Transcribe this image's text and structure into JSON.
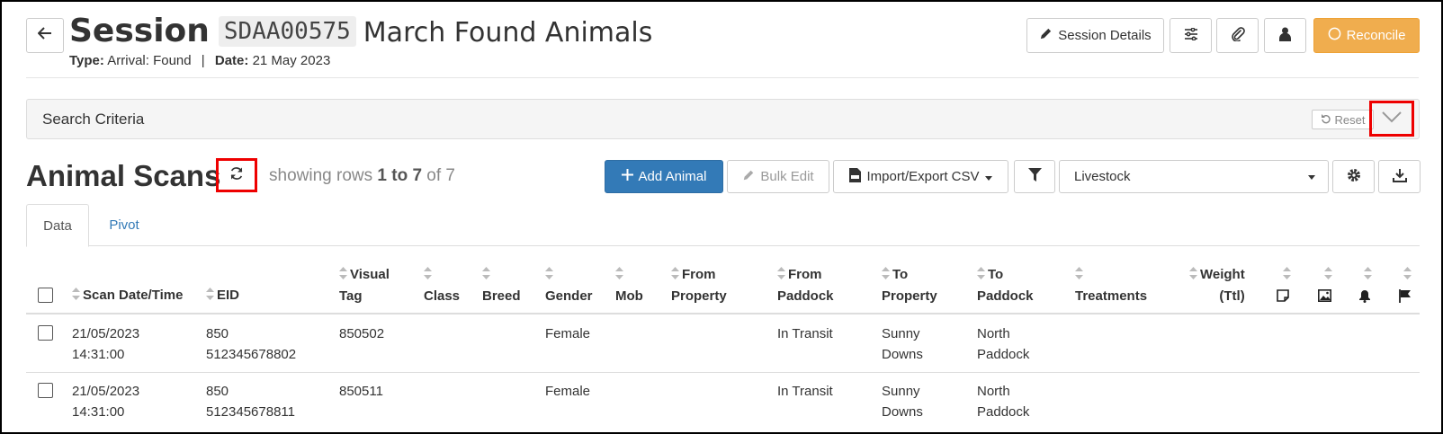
{
  "session": {
    "title_word": "Session",
    "code": "SDAA00575",
    "name": "March Found Animals",
    "type_label": "Type:",
    "type_value": "Arrival: Found",
    "separator": "|",
    "date_label": "Date:",
    "date_value": "21 May 2023"
  },
  "header_buttons": {
    "session_details": "Session Details",
    "reconcile": "Reconcile"
  },
  "search": {
    "label": "Search Criteria",
    "reset": "Reset"
  },
  "scans": {
    "title": "Animal Scans",
    "showing_prefix": "showing rows",
    "showing_range": "1 to 7",
    "showing_of": "of 7"
  },
  "toolbar": {
    "add_animal": "Add Animal",
    "bulk_edit": "Bulk Edit",
    "import_export": "Import/Export CSV",
    "livestock_selected": "Livestock"
  },
  "tabs": [
    "Data",
    "Pivot"
  ],
  "table": {
    "headers": {
      "scan": "Scan Date/Time",
      "eid": "EID",
      "visual_1": "Visual",
      "visual_2": "Tag",
      "class": "Class",
      "breed": "Breed",
      "gender": "Gender",
      "mob": "Mob",
      "from_prop_1": "From",
      "from_prop_2": "Property",
      "from_pad_1": "From",
      "from_pad_2": "Paddock",
      "to_prop_1": "To",
      "to_prop_2": "Property",
      "to_pad_1": "To",
      "to_pad_2": "Paddock",
      "treatments": "Treatments",
      "weight_1": "Weight",
      "weight_2": "(Ttl)"
    },
    "rows": [
      {
        "date": "21/05/2023",
        "time": "14:31:00",
        "eid_1": "850",
        "eid_2": "512345678802",
        "visual_tag": "850502",
        "gender": "Female",
        "from_paddock": "In Transit",
        "to_property_1": "Sunny",
        "to_property_2": "Downs",
        "to_paddock_1": "North",
        "to_paddock_2": "Paddock"
      },
      {
        "date": "21/05/2023",
        "time": "14:31:00",
        "eid_1": "850",
        "eid_2": "512345678811",
        "visual_tag": "850511",
        "gender": "Female",
        "from_paddock": "In Transit",
        "to_property_1": "Sunny",
        "to_property_2": "Downs",
        "to_paddock_1": "North",
        "to_paddock_2": "Paddock"
      }
    ]
  },
  "colors": {
    "primary": "#337ab7",
    "warning": "#f0ad4e",
    "highlight": "#ee0000"
  },
  "icons": [
    "arrow-left-icon",
    "pencil-icon",
    "sliders-icon",
    "paperclip-icon",
    "user-icon",
    "circle-icon",
    "undo-icon",
    "chevron-down-icon",
    "refresh-icon",
    "plus-icon",
    "csv-file-icon",
    "filter-icon",
    "gear-icon",
    "download-icon",
    "sort-icon",
    "note-icon",
    "image-icon",
    "bell-icon",
    "flag-icon"
  ]
}
